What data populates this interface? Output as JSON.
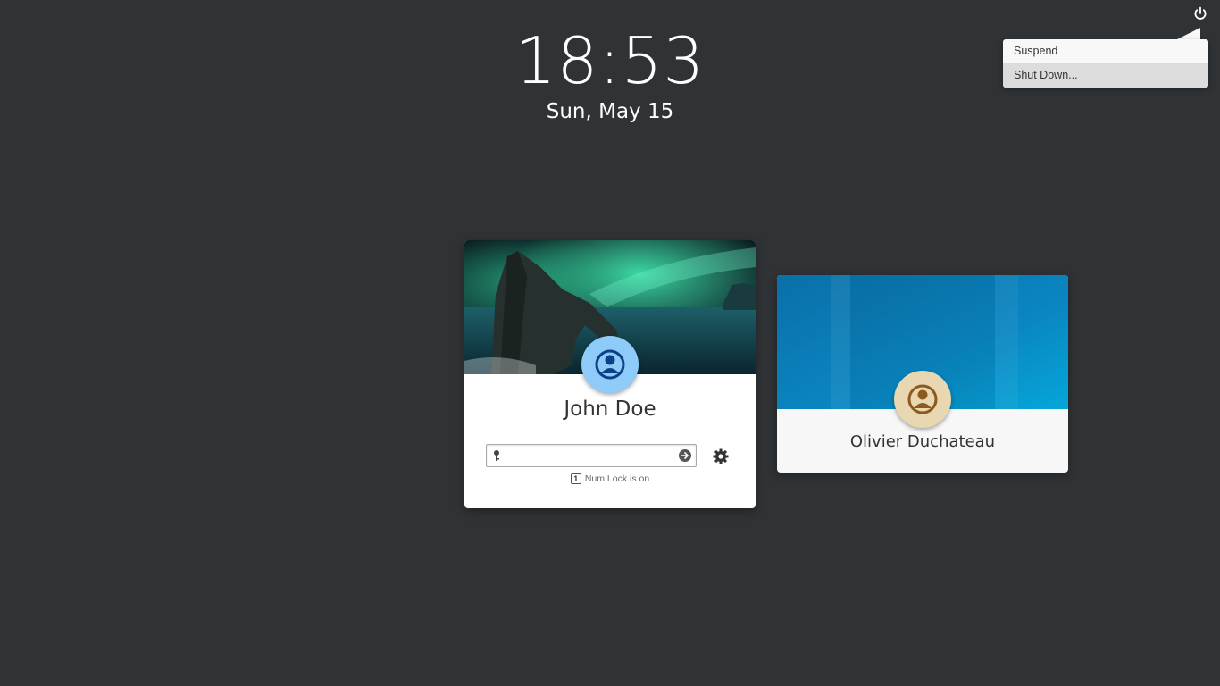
{
  "clock": {
    "time": "18:53",
    "date": "Sun, May 15"
  },
  "power_menu": {
    "items": [
      {
        "label": "Suspend",
        "selected": false
      },
      {
        "label": "Shut Down...",
        "selected": true
      }
    ]
  },
  "users": [
    {
      "name": "John Doe",
      "avatar_color": "#8fcbf8",
      "avatar_icon": "user-icon",
      "password_placeholder": "",
      "num_lock_label": "Num Lock is on",
      "num_lock_glyph": "1"
    },
    {
      "name": "Olivier Duchateau",
      "avatar_color": "#e8d7b0",
      "avatar_icon": "user-icon"
    }
  ],
  "colors": {
    "background": "#2f3336",
    "menu_selected": "#dcdcdc",
    "accent_blue": "#0a74b4"
  }
}
